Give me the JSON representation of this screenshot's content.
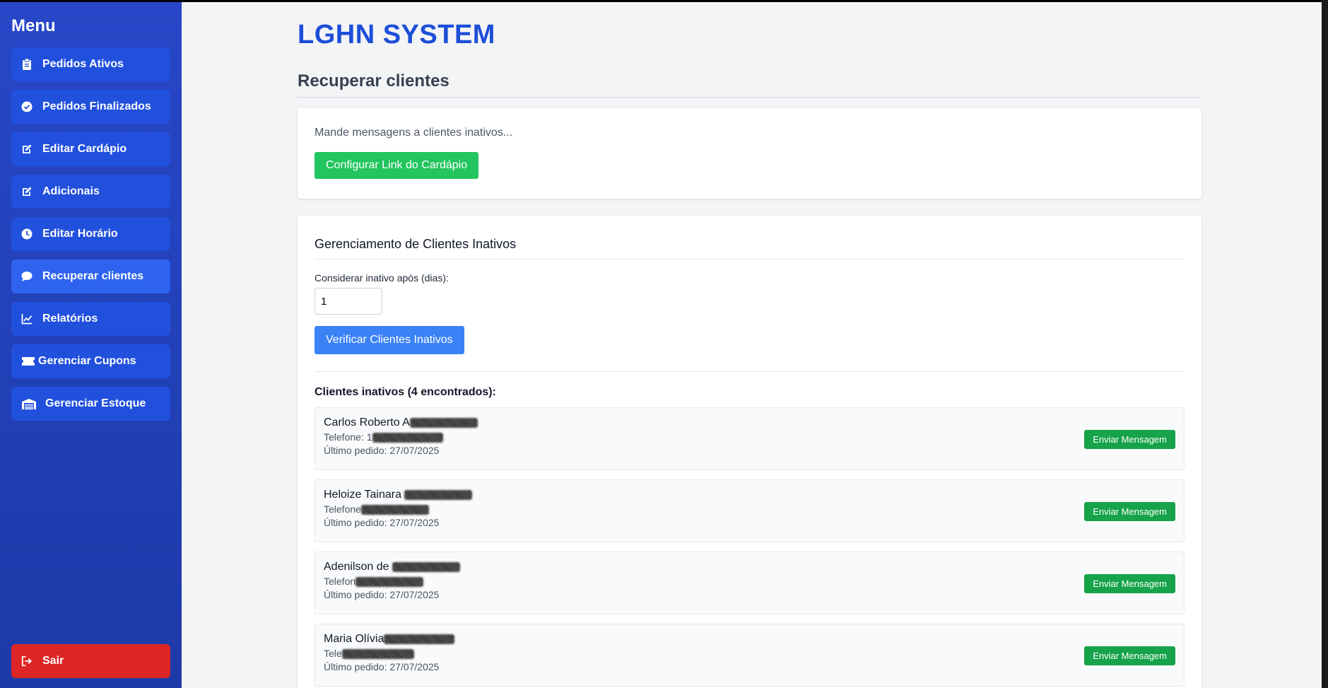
{
  "sidebar": {
    "title": "Menu",
    "items": [
      {
        "label": "Pedidos Ativos",
        "icon": "clipboard-icon"
      },
      {
        "label": "Pedidos Finalizados",
        "icon": "check-circle-icon"
      },
      {
        "label": "Editar Cardápio",
        "icon": "edit-icon"
      },
      {
        "label": "Adicionais",
        "icon": "edit-icon"
      },
      {
        "label": "Editar Horário",
        "icon": "clock-icon"
      },
      {
        "label": "Recuperar clientes",
        "icon": "chat-icon",
        "active": true
      },
      {
        "label": "Relatórios",
        "icon": "chart-line-icon"
      },
      {
        "label": "Gerenciar Cupons",
        "icon": "ticket-icon"
      },
      {
        "label": "Gerenciar Estoque",
        "icon": "warehouse-icon"
      }
    ],
    "logout_label": "Sair"
  },
  "header": {
    "app_title": "LGHN SYSTEM"
  },
  "page": {
    "section_title": "Recuperar clientes"
  },
  "intro_card": {
    "description": "Mande mensagens a clientes inativos...",
    "config_button": "Configurar Link do Cardápio"
  },
  "inactive_card": {
    "title": "Gerenciamento de Clientes Inativos",
    "days_label": "Considerar inativo após (dias):",
    "days_value": "1",
    "verify_button": "Verificar Clientes Inativos",
    "found_label": "Clientes inativos (4 encontrados):"
  },
  "clients": [
    {
      "name": "Carlos Roberto A",
      "phone_label": "Telefone: 1",
      "last_order": "Último pedido: 27/07/2025",
      "button": "Enviar Mensagem"
    },
    {
      "name": "Heloize Tainara",
      "phone_label": "Telefone",
      "last_order": "Último pedido: 27/07/2025",
      "button": "Enviar Mensagem"
    },
    {
      "name": "Adenilson de",
      "phone_label": "Telefon",
      "last_order": "Último pedido: 27/07/2025",
      "button": "Enviar Mensagem"
    },
    {
      "name": "Maria Olívia",
      "phone_label": "Tele",
      "last_order": "Último pedido: 27/07/2025",
      "button": "Enviar Mensagem"
    }
  ],
  "colors": {
    "sidebar": "#2747c8",
    "nav_item": "#2150dd",
    "accent_title": "#1d4ed8",
    "green": "#22c55e",
    "blue": "#3b82f6",
    "danger": "#dc2626"
  }
}
